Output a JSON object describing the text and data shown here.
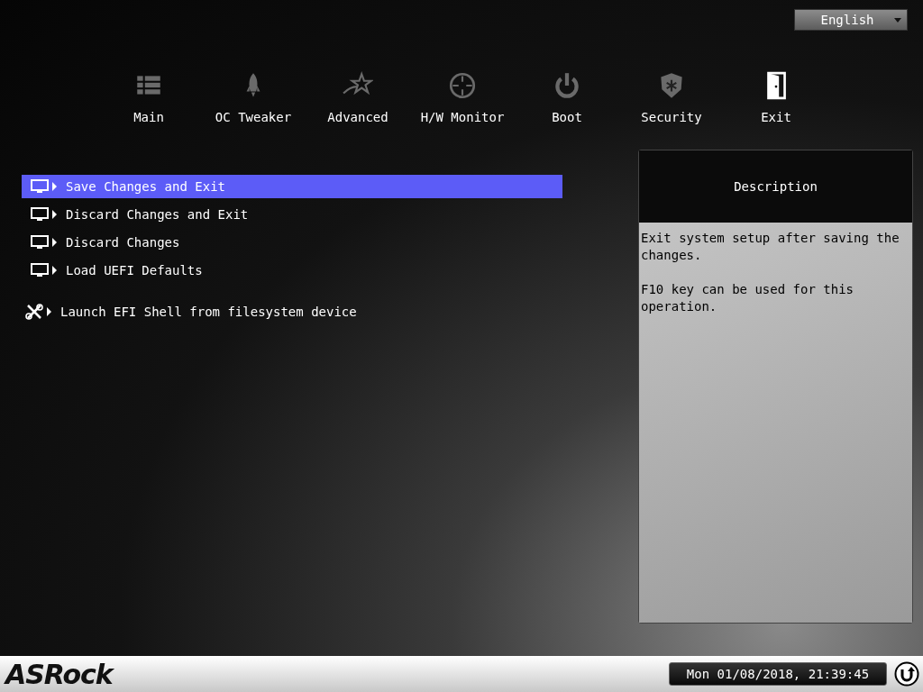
{
  "language": {
    "value": "English"
  },
  "tabs": [
    {
      "label": "Main",
      "kind": "list",
      "selected": false
    },
    {
      "label": "OC Tweaker",
      "kind": "rocket",
      "selected": false
    },
    {
      "label": "Advanced",
      "kind": "star",
      "selected": false
    },
    {
      "label": "H/W Monitor",
      "kind": "target",
      "selected": false
    },
    {
      "label": "Boot",
      "kind": "power",
      "selected": false
    },
    {
      "label": "Security",
      "kind": "badge",
      "selected": false
    },
    {
      "label": "Exit",
      "kind": "door",
      "selected": true
    }
  ],
  "menu": [
    {
      "label": "Save Changes and Exit",
      "kind": "screen",
      "selected": true
    },
    {
      "label": "Discard Changes and Exit",
      "kind": "screen",
      "selected": false
    },
    {
      "label": "Discard Changes",
      "kind": "screen",
      "selected": false
    },
    {
      "label": "Load UEFI Defaults",
      "kind": "screen",
      "selected": false
    },
    {
      "label": "Launch EFI Shell from filesystem device",
      "kind": "tool",
      "selected": false
    }
  ],
  "description": {
    "title": "Description",
    "paragraphs": [
      "Exit system setup after saving the changes.",
      "F10 key can be used for this operation."
    ]
  },
  "footer": {
    "logo": "ASRock",
    "datetime": "Mon 01/08/2018, 21:39:45"
  }
}
